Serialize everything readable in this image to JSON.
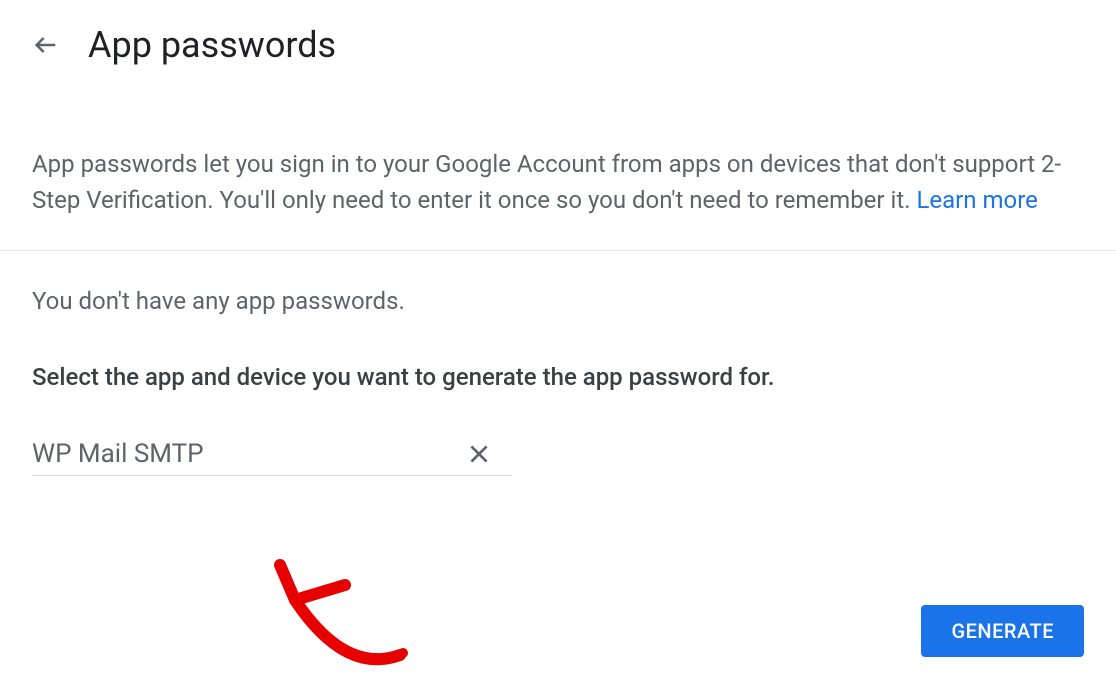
{
  "header": {
    "title": "App passwords"
  },
  "description": {
    "text": "App passwords let you sign in to your Google Account from apps on devices that don't support 2-Step Verification. You'll only need to enter it once so you don't need to remember it. ",
    "learn_more": "Learn more"
  },
  "content": {
    "no_passwords_text": "You don't have any app passwords.",
    "select_instruction": "Select the app and device you want to generate the app password for.",
    "input_value": "WP Mail SMTP"
  },
  "buttons": {
    "generate": "GENERATE"
  }
}
